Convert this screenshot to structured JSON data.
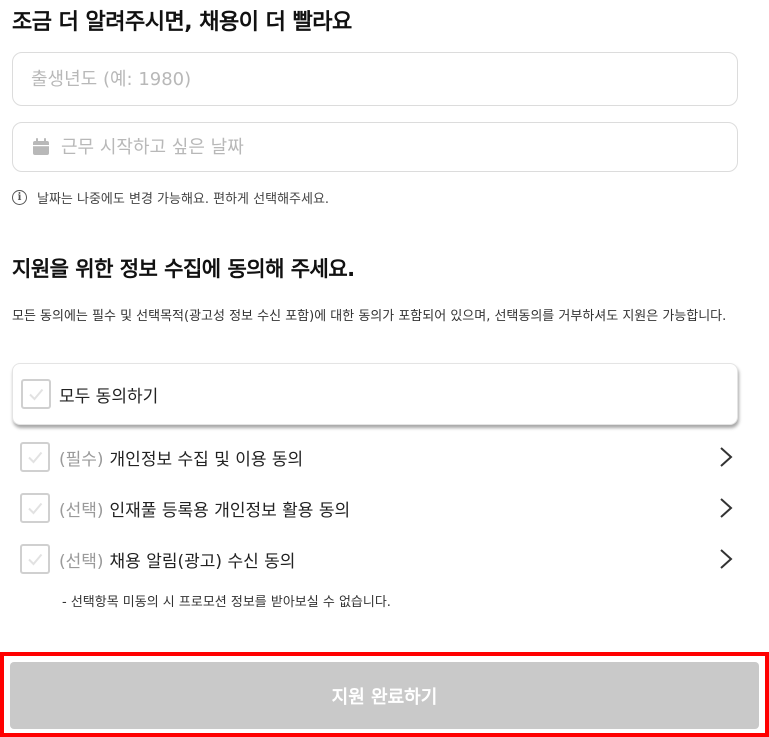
{
  "header": {
    "title": "조금 더 알려주시면, 채용이 더 빨라요"
  },
  "form": {
    "birth_year": {
      "value": "",
      "placeholder": "출생년도 (예: 1980)"
    },
    "start_date": {
      "value": "",
      "placeholder": "근무 시작하고 싶은 날짜",
      "icon": "calendar-icon"
    },
    "date_notice": "날짜는 나중에도 변경 가능해요. 편하게 선택해주세요.",
    "notice_icon": "info-icon"
  },
  "consent": {
    "title": "지원을 위한 정보 수집에 동의해 주세요.",
    "description": "모든 동의에는 필수 및 선택목적(광고성 정보 수신 포함)에 대한 동의가 포함되어 있으며, 선택동의를 거부하셔도 지원은 가능합니다.",
    "all_label": "모두 동의하기",
    "items": [
      {
        "tag": "(필수)",
        "label": "개인정보 수집 및 이용 동의",
        "checked": false
      },
      {
        "tag": "(선택)",
        "label": "인재풀 등록용 개인정보 활용 동의",
        "checked": false
      },
      {
        "tag": "(선택)",
        "label": "채용 알림(광고) 수신 동의",
        "checked": false
      }
    ],
    "note": "- 선택항목 미동의 시 프로모션 정보를 받아보실 수 없습니다."
  },
  "footer": {
    "submit_label": "지원 완료하기"
  },
  "colors": {
    "disabled_button": "#c9c9c9",
    "highlight_border": "#ff0000",
    "placeholder": "#b8b8b8"
  }
}
